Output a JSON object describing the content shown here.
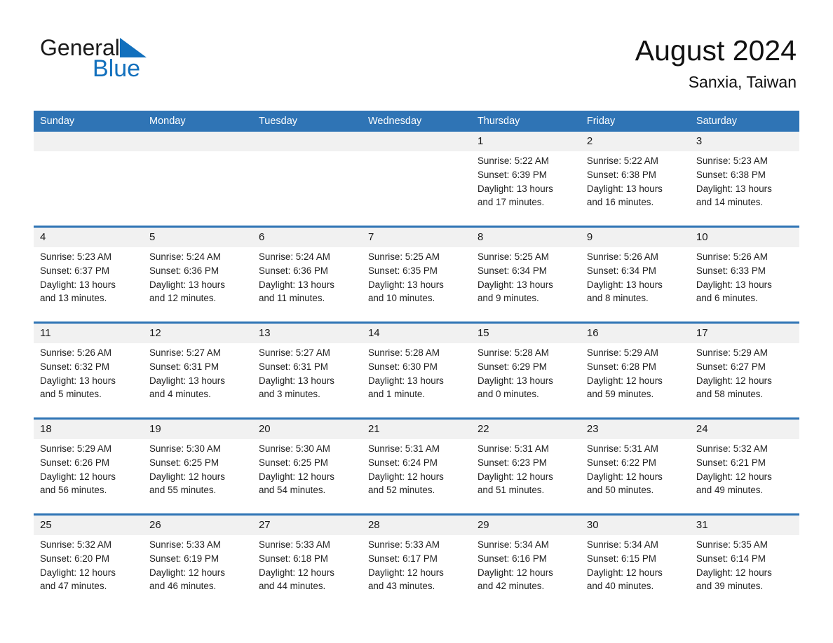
{
  "brand": {
    "name_part1": "General",
    "name_part2": "Blue",
    "triangle_color": "#1270bd",
    "text_color": "#1a1a1a"
  },
  "header": {
    "title": "August 2024",
    "subtitle": "Sanxia, Taiwan"
  },
  "theme": {
    "header_blue": "#2f74b5",
    "daynum_band": "#f1f1f1",
    "cell_background": "#ffffff"
  },
  "weekdays": [
    "Sunday",
    "Monday",
    "Tuesday",
    "Wednesday",
    "Thursday",
    "Friday",
    "Saturday"
  ],
  "weeks": [
    [
      {
        "day": "",
        "sunrise": "",
        "sunset": "",
        "daylight1": "",
        "daylight2": ""
      },
      {
        "day": "",
        "sunrise": "",
        "sunset": "",
        "daylight1": "",
        "daylight2": ""
      },
      {
        "day": "",
        "sunrise": "",
        "sunset": "",
        "daylight1": "",
        "daylight2": ""
      },
      {
        "day": "",
        "sunrise": "",
        "sunset": "",
        "daylight1": "",
        "daylight2": ""
      },
      {
        "day": "1",
        "sunrise": "Sunrise: 5:22 AM",
        "sunset": "Sunset: 6:39 PM",
        "daylight1": "Daylight: 13 hours",
        "daylight2": "and 17 minutes."
      },
      {
        "day": "2",
        "sunrise": "Sunrise: 5:22 AM",
        "sunset": "Sunset: 6:38 PM",
        "daylight1": "Daylight: 13 hours",
        "daylight2": "and 16 minutes."
      },
      {
        "day": "3",
        "sunrise": "Sunrise: 5:23 AM",
        "sunset": "Sunset: 6:38 PM",
        "daylight1": "Daylight: 13 hours",
        "daylight2": "and 14 minutes."
      }
    ],
    [
      {
        "day": "4",
        "sunrise": "Sunrise: 5:23 AM",
        "sunset": "Sunset: 6:37 PM",
        "daylight1": "Daylight: 13 hours",
        "daylight2": "and 13 minutes."
      },
      {
        "day": "5",
        "sunrise": "Sunrise: 5:24 AM",
        "sunset": "Sunset: 6:36 PM",
        "daylight1": "Daylight: 13 hours",
        "daylight2": "and 12 minutes."
      },
      {
        "day": "6",
        "sunrise": "Sunrise: 5:24 AM",
        "sunset": "Sunset: 6:36 PM",
        "daylight1": "Daylight: 13 hours",
        "daylight2": "and 11 minutes."
      },
      {
        "day": "7",
        "sunrise": "Sunrise: 5:25 AM",
        "sunset": "Sunset: 6:35 PM",
        "daylight1": "Daylight: 13 hours",
        "daylight2": "and 10 minutes."
      },
      {
        "day": "8",
        "sunrise": "Sunrise: 5:25 AM",
        "sunset": "Sunset: 6:34 PM",
        "daylight1": "Daylight: 13 hours",
        "daylight2": "and 9 minutes."
      },
      {
        "day": "9",
        "sunrise": "Sunrise: 5:26 AM",
        "sunset": "Sunset: 6:34 PM",
        "daylight1": "Daylight: 13 hours",
        "daylight2": "and 8 minutes."
      },
      {
        "day": "10",
        "sunrise": "Sunrise: 5:26 AM",
        "sunset": "Sunset: 6:33 PM",
        "daylight1": "Daylight: 13 hours",
        "daylight2": "and 6 minutes."
      }
    ],
    [
      {
        "day": "11",
        "sunrise": "Sunrise: 5:26 AM",
        "sunset": "Sunset: 6:32 PM",
        "daylight1": "Daylight: 13 hours",
        "daylight2": "and 5 minutes."
      },
      {
        "day": "12",
        "sunrise": "Sunrise: 5:27 AM",
        "sunset": "Sunset: 6:31 PM",
        "daylight1": "Daylight: 13 hours",
        "daylight2": "and 4 minutes."
      },
      {
        "day": "13",
        "sunrise": "Sunrise: 5:27 AM",
        "sunset": "Sunset: 6:31 PM",
        "daylight1": "Daylight: 13 hours",
        "daylight2": "and 3 minutes."
      },
      {
        "day": "14",
        "sunrise": "Sunrise: 5:28 AM",
        "sunset": "Sunset: 6:30 PM",
        "daylight1": "Daylight: 13 hours",
        "daylight2": "and 1 minute."
      },
      {
        "day": "15",
        "sunrise": "Sunrise: 5:28 AM",
        "sunset": "Sunset: 6:29 PM",
        "daylight1": "Daylight: 13 hours",
        "daylight2": "and 0 minutes."
      },
      {
        "day": "16",
        "sunrise": "Sunrise: 5:29 AM",
        "sunset": "Sunset: 6:28 PM",
        "daylight1": "Daylight: 12 hours",
        "daylight2": "and 59 minutes."
      },
      {
        "day": "17",
        "sunrise": "Sunrise: 5:29 AM",
        "sunset": "Sunset: 6:27 PM",
        "daylight1": "Daylight: 12 hours",
        "daylight2": "and 58 minutes."
      }
    ],
    [
      {
        "day": "18",
        "sunrise": "Sunrise: 5:29 AM",
        "sunset": "Sunset: 6:26 PM",
        "daylight1": "Daylight: 12 hours",
        "daylight2": "and 56 minutes."
      },
      {
        "day": "19",
        "sunrise": "Sunrise: 5:30 AM",
        "sunset": "Sunset: 6:25 PM",
        "daylight1": "Daylight: 12 hours",
        "daylight2": "and 55 minutes."
      },
      {
        "day": "20",
        "sunrise": "Sunrise: 5:30 AM",
        "sunset": "Sunset: 6:25 PM",
        "daylight1": "Daylight: 12 hours",
        "daylight2": "and 54 minutes."
      },
      {
        "day": "21",
        "sunrise": "Sunrise: 5:31 AM",
        "sunset": "Sunset: 6:24 PM",
        "daylight1": "Daylight: 12 hours",
        "daylight2": "and 52 minutes."
      },
      {
        "day": "22",
        "sunrise": "Sunrise: 5:31 AM",
        "sunset": "Sunset: 6:23 PM",
        "daylight1": "Daylight: 12 hours",
        "daylight2": "and 51 minutes."
      },
      {
        "day": "23",
        "sunrise": "Sunrise: 5:31 AM",
        "sunset": "Sunset: 6:22 PM",
        "daylight1": "Daylight: 12 hours",
        "daylight2": "and 50 minutes."
      },
      {
        "day": "24",
        "sunrise": "Sunrise: 5:32 AM",
        "sunset": "Sunset: 6:21 PM",
        "daylight1": "Daylight: 12 hours",
        "daylight2": "and 49 minutes."
      }
    ],
    [
      {
        "day": "25",
        "sunrise": "Sunrise: 5:32 AM",
        "sunset": "Sunset: 6:20 PM",
        "daylight1": "Daylight: 12 hours",
        "daylight2": "and 47 minutes."
      },
      {
        "day": "26",
        "sunrise": "Sunrise: 5:33 AM",
        "sunset": "Sunset: 6:19 PM",
        "daylight1": "Daylight: 12 hours",
        "daylight2": "and 46 minutes."
      },
      {
        "day": "27",
        "sunrise": "Sunrise: 5:33 AM",
        "sunset": "Sunset: 6:18 PM",
        "daylight1": "Daylight: 12 hours",
        "daylight2": "and 44 minutes."
      },
      {
        "day": "28",
        "sunrise": "Sunrise: 5:33 AM",
        "sunset": "Sunset: 6:17 PM",
        "daylight1": "Daylight: 12 hours",
        "daylight2": "and 43 minutes."
      },
      {
        "day": "29",
        "sunrise": "Sunrise: 5:34 AM",
        "sunset": "Sunset: 6:16 PM",
        "daylight1": "Daylight: 12 hours",
        "daylight2": "and 42 minutes."
      },
      {
        "day": "30",
        "sunrise": "Sunrise: 5:34 AM",
        "sunset": "Sunset: 6:15 PM",
        "daylight1": "Daylight: 12 hours",
        "daylight2": "and 40 minutes."
      },
      {
        "day": "31",
        "sunrise": "Sunrise: 5:35 AM",
        "sunset": "Sunset: 6:14 PM",
        "daylight1": "Daylight: 12 hours",
        "daylight2": "and 39 minutes."
      }
    ]
  ]
}
